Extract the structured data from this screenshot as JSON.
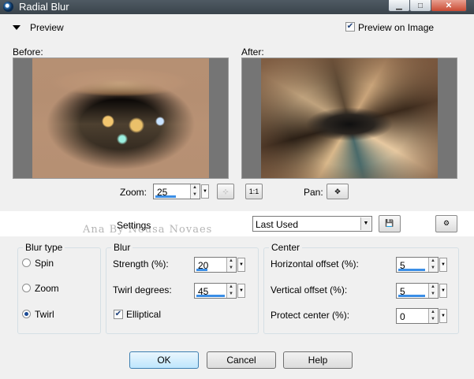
{
  "window": {
    "title": "Radial Blur"
  },
  "preview": {
    "section_label": "Preview",
    "preview_on_image_label": "Preview on Image",
    "preview_on_image_checked": true,
    "before_label": "Before:",
    "after_label": "After:",
    "zoom_label": "Zoom:",
    "zoom_value": "25",
    "pan_label": "Pan:",
    "one_to_one_label": "1:1"
  },
  "settings": {
    "label": "Settings",
    "preset_value": "Last Used",
    "watermark": "Ana By Neusa Novaes"
  },
  "blur_type": {
    "title": "Blur type",
    "options": [
      {
        "label": "Spin",
        "selected": false
      },
      {
        "label": "Zoom",
        "selected": false
      },
      {
        "label": "Twirl",
        "selected": true
      }
    ]
  },
  "blur": {
    "title": "Blur",
    "strength_label": "Strength (%):",
    "strength_value": "20",
    "twirl_label": "Twirl degrees:",
    "twirl_value": "45",
    "elliptical_label": "Elliptical",
    "elliptical_checked": true
  },
  "center": {
    "title": "Center",
    "h_offset_label": "Horizontal offset (%):",
    "h_offset_value": "5",
    "v_offset_label": "Vertical offset (%):",
    "v_offset_value": "5",
    "protect_label": "Protect center (%):",
    "protect_value": "0"
  },
  "buttons": {
    "ok": "OK",
    "cancel": "Cancel",
    "help": "Help"
  },
  "colors": {
    "accent": "#3a8ee6",
    "titlebar": "#3a444c"
  }
}
